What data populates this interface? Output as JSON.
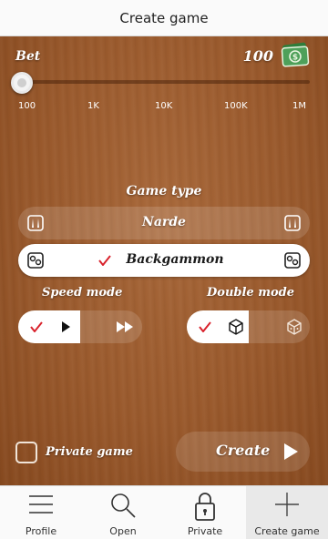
{
  "header": {
    "title": "Create game"
  },
  "bet": {
    "label": "Bet",
    "value": "100",
    "currency_icon": "money-icon",
    "slider_position": 0.0,
    "ticks": [
      "100",
      "1K",
      "10K",
      "100K",
      "1M"
    ]
  },
  "game_type": {
    "label": "Game type",
    "options": [
      {
        "name": "Narde",
        "selected": false,
        "icon": "narde-icon"
      },
      {
        "name": "Backgammon",
        "selected": true,
        "icon": "backgammon-icon"
      }
    ]
  },
  "speed_mode": {
    "label": "Speed mode",
    "options": [
      {
        "icon": "play-icon",
        "selected": true
      },
      {
        "icon": "fast-forward-icon",
        "selected": false
      }
    ]
  },
  "double_mode": {
    "label": "Double mode",
    "options": [
      {
        "icon": "dice-cube-icon",
        "selected": true
      },
      {
        "icon": "doubling-cube-icon",
        "selected": false
      }
    ]
  },
  "private_game": {
    "label": "Private game",
    "checked": false
  },
  "create_button": {
    "label": "Create"
  },
  "bottom_nav": [
    {
      "label": "Profile",
      "icon": "menu-icon",
      "active": false
    },
    {
      "label": "Open",
      "icon": "search-icon",
      "active": false
    },
    {
      "label": "Private",
      "icon": "lock-icon",
      "active": false
    },
    {
      "label": "Create game",
      "icon": "plus-icon",
      "active": true
    }
  ],
  "colors": {
    "accent_check": "#d9232d",
    "wood": "#99592c"
  }
}
